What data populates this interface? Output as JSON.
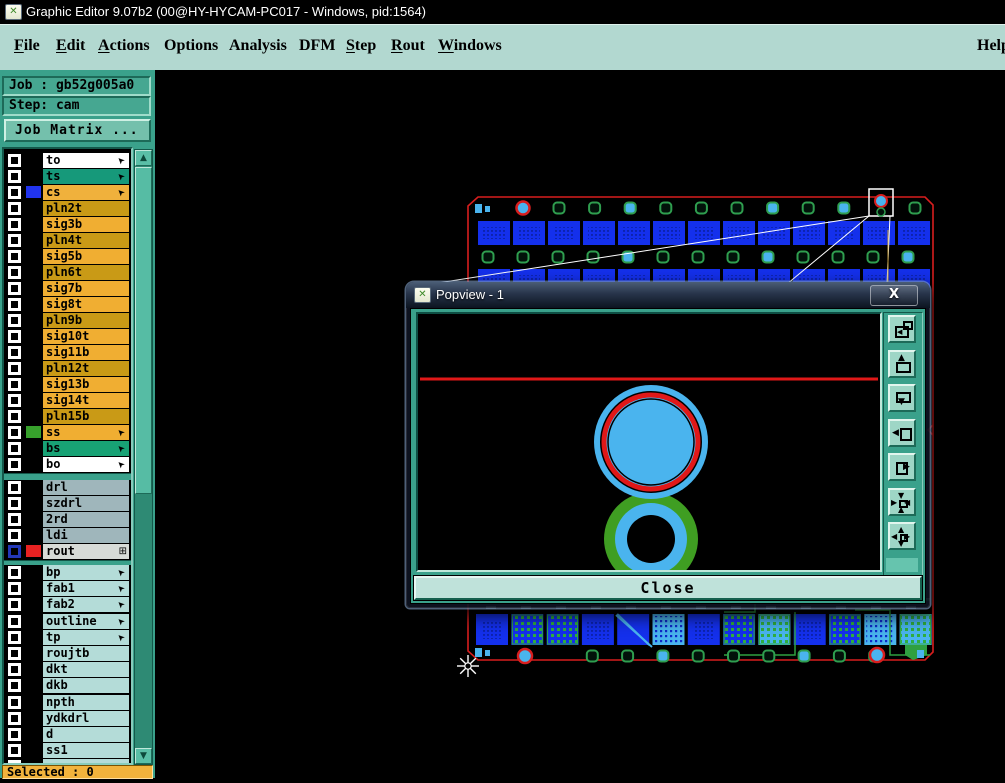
{
  "window": {
    "title": "Graphic Editor 9.07b2 (00@HY-HYCAM-PC017 - Windows, pid:1564)"
  },
  "menu": {
    "items": [
      {
        "label": "File",
        "accel": "F"
      },
      {
        "label": "Edit",
        "accel": "E"
      },
      {
        "label": "Actions",
        "accel": "A"
      },
      {
        "label": "Options",
        "accel": ""
      },
      {
        "label": "Analysis",
        "accel": ""
      },
      {
        "label": "DFM",
        "accel": ""
      },
      {
        "label": "Step",
        "accel": "S"
      },
      {
        "label": "Rout",
        "accel": "R"
      },
      {
        "label": "Windows",
        "accel": "W"
      }
    ],
    "help_label": "Help"
  },
  "sidebar": {
    "job_label": "Job : gb52g005a0",
    "step_label": "Step: cam",
    "job_matrix_button": "Job Matrix ...",
    "selected_status": "Selected : 0",
    "layer_groups": [
      {
        "name": "board-layers",
        "rows": [
          {
            "label": "to",
            "bg": "#ffffff",
            "arrow": true
          },
          {
            "label": "ts",
            "bg": "#16997a",
            "arrow": true
          },
          {
            "label": "cs",
            "bg": "#f0b13c",
            "swatch": "#2134ef",
            "arrow": true
          },
          {
            "label": "pln2t",
            "bg": "#c99a16"
          },
          {
            "label": "sig3b",
            "bg": "#f0ae32"
          },
          {
            "label": "pln4t",
            "bg": "#c99a16"
          },
          {
            "label": "sig5b",
            "bg": "#f0ae32"
          },
          {
            "label": "pln6t",
            "bg": "#c99a16"
          },
          {
            "label": "sig7b",
            "bg": "#f0ae32"
          },
          {
            "label": "sig8t",
            "bg": "#f0ae32"
          },
          {
            "label": "pln9b",
            "bg": "#c99a16"
          },
          {
            "label": "sig10t",
            "bg": "#f0ae32"
          },
          {
            "label": "sig11b",
            "bg": "#f0ae32"
          },
          {
            "label": "pln12t",
            "bg": "#c99a16"
          },
          {
            "label": "sig13b",
            "bg": "#f0ae32"
          },
          {
            "label": "sig14t",
            "bg": "#f0ae32"
          },
          {
            "label": "pln15b",
            "bg": "#c99a16"
          },
          {
            "label": "ss",
            "bg": "#f0ae32",
            "swatch": "#37a02c",
            "arrow": true
          },
          {
            "label": "bs",
            "bg": "#18a275",
            "arrow": true
          },
          {
            "label": "bo",
            "bg": "#ffffff",
            "arrow": true
          }
        ]
      },
      {
        "name": "drill-layers",
        "rows": [
          {
            "label": "drl",
            "bg": "#9fb6bb"
          },
          {
            "label": "szdrl",
            "bg": "#9fb6bb"
          },
          {
            "label": "2rd",
            "bg": "#9fb6bb"
          },
          {
            "label": "ldi",
            "bg": "#9fb6bb"
          },
          {
            "label": "rout",
            "bg": "#d7dbd7",
            "swatch": "#e82222",
            "checkbox_border": "#2438b8",
            "grid_icon": true
          }
        ]
      },
      {
        "name": "misc-layers",
        "rows": [
          {
            "label": "bp",
            "bg": "#b4dcd8",
            "arrow": true
          },
          {
            "label": "fab1",
            "bg": "#b4dcd8",
            "arrow": true
          },
          {
            "label": "fab2",
            "bg": "#b4dcd8",
            "arrow": true
          },
          {
            "label": "outline",
            "bg": "#b4dcd8",
            "arrow": true
          },
          {
            "label": "tp",
            "bg": "#b4dcd8",
            "arrow": true
          },
          {
            "label": "roujtb",
            "bg": "#b4dcd8"
          },
          {
            "label": "dkt",
            "bg": "#b4dcd8"
          },
          {
            "label": "dkb",
            "bg": "#b4dcd8"
          },
          {
            "label": "npth",
            "bg": "#b4dcd8"
          },
          {
            "label": "ydkdrl",
            "bg": "#b4dcd8"
          },
          {
            "label": "d",
            "bg": "#b4dcd8"
          },
          {
            "label": "ss1",
            "bg": "#b4dcd8"
          },
          {
            "label": "",
            "bg": "#b4dcd8",
            "partial": true
          }
        ]
      }
    ]
  },
  "popview": {
    "title": "Popview - 1",
    "close_x": "X",
    "close_label": "Close",
    "toolbar_icons": [
      "new-popview-icon",
      "shift-up-icon",
      "shift-down-icon",
      "shift-left-icon",
      "shift-right-icon",
      "zoom-fit-icon",
      "pan-icon"
    ]
  },
  "icons": {
    "window_x": "✕",
    "layer_arrow": "➤",
    "grid": "⊞",
    "scroll_up": "▲",
    "scroll_down": "▼",
    "up": "▲",
    "down": "▼",
    "left": "◀",
    "right": "▶"
  },
  "colors": {
    "pcb_outline_red": "#d81e1e",
    "pad_blue": "#1430ec",
    "via_green": "#2f9e4f",
    "light_blue": "#4ab4ee",
    "trace_green": "#2fa040",
    "popview_red_line": "#e01818",
    "popview_green": "#3f9e22",
    "panel_teal": "#3aa18b",
    "menu_bg": "#b2d8d0",
    "selected_bar_orange": "#f2b33c",
    "callout_white": "#ffffff"
  }
}
